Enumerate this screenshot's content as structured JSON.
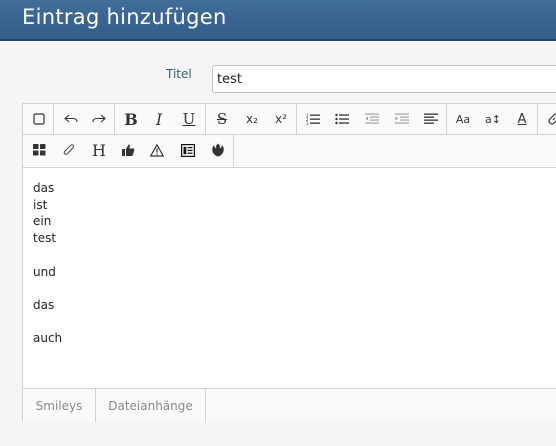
{
  "header": {
    "title": "Eintrag hinzufügen"
  },
  "form": {
    "title_label": "Titel",
    "title_value": "test"
  },
  "toolbar": {
    "bold": "B",
    "italic": "I",
    "underline": "U",
    "subscript": "x₂",
    "superscript": "x²",
    "font_size": "Aa",
    "font_family": "a↕",
    "font_color": "A",
    "heading": "H"
  },
  "content": {
    "lines": [
      "das",
      "ist",
      "ein",
      "test",
      "",
      "und",
      "",
      "das",
      "",
      "auch"
    ]
  },
  "tabs": {
    "smileys": "Smileys",
    "attachments": "Dateianhänge"
  }
}
